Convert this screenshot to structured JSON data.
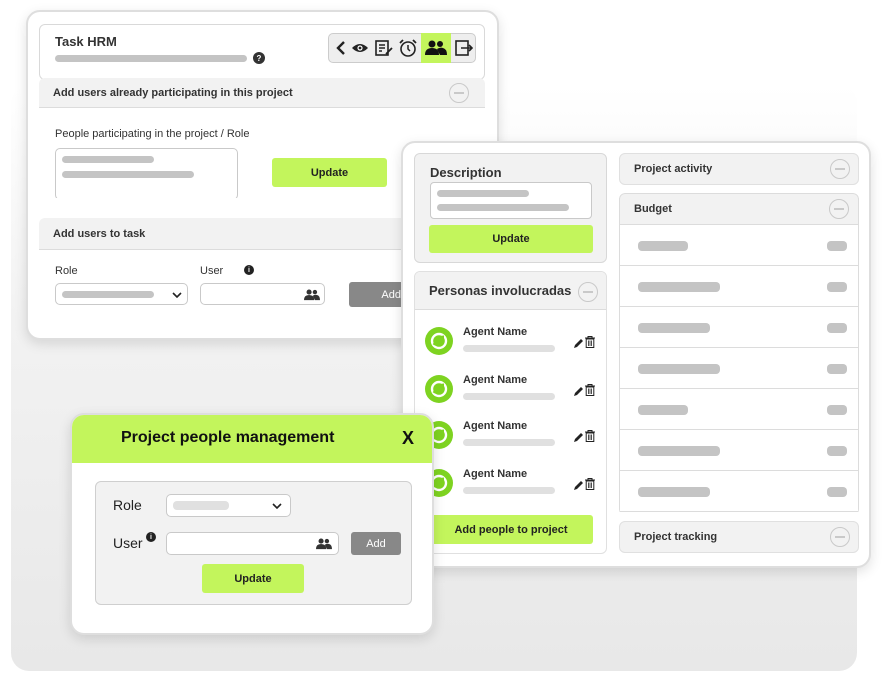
{
  "task_card": {
    "title": "Task HRM",
    "help_icon": "?",
    "section_add_participating": "Add users already participating in this project",
    "people_role_label": "People participating in the project / Role",
    "update_label": "Update",
    "section_add_to_task": "Add users to task",
    "role_label": "Role",
    "user_label": "User",
    "info_icon": "i",
    "add_label": "Add"
  },
  "project_card": {
    "description_title": "Description",
    "update_label": "Update",
    "people_title": "Personas involucradas",
    "agents": [
      {
        "name": "Agent Name"
      },
      {
        "name": "Agent Name"
      },
      {
        "name": "Agent Name"
      },
      {
        "name": "Agent Name"
      }
    ],
    "add_people_label": "Add people to project",
    "project_activity": "Project activity",
    "budget": "Budget",
    "project_tracking": "Project tracking"
  },
  "modal": {
    "title": "Project people management",
    "close": "X",
    "role_label": "Role",
    "user_label": "User",
    "info_icon": "i",
    "add_label": "Add",
    "update_label": "Update"
  },
  "colors": {
    "accent": "#c3f55c",
    "agent_green": "#7ed321",
    "muted_bar": "#c4c4c4"
  }
}
